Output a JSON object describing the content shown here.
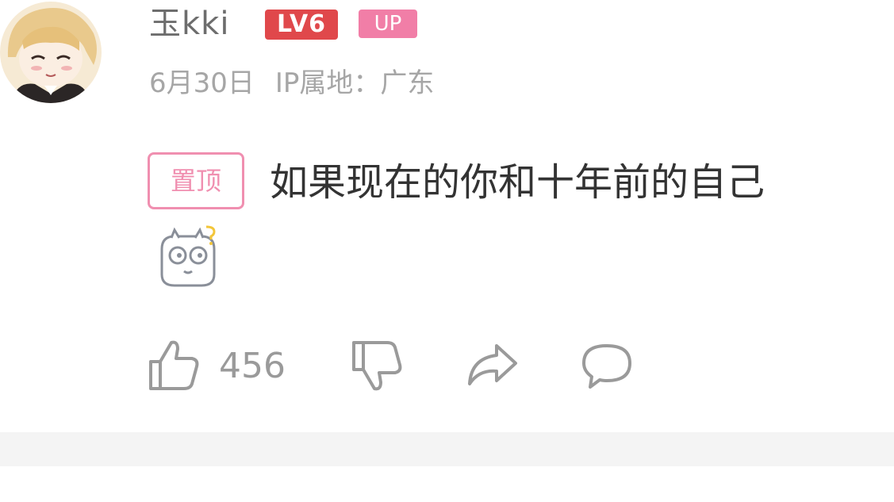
{
  "comment": {
    "username": "玉kki",
    "level_badge": "LV6",
    "up_badge": "UP",
    "date": "6月30日",
    "ip_location": "IP属地：广东",
    "pin_tag": "置顶",
    "text": "如果现在的你和十年前的自己",
    "like_count": "456"
  },
  "colors": {
    "level_badge": "#e0484b",
    "up_badge": "#f17ea7",
    "pin_tag": "#f08fb0",
    "meta_text": "#a6a6a6",
    "icon_stroke": "#9a9a9a"
  },
  "icons": [
    "thumbs-up-icon",
    "thumbs-down-icon",
    "share-icon",
    "reply-icon",
    "sticker-emoji-icon"
  ]
}
